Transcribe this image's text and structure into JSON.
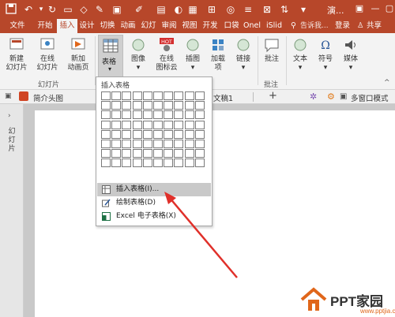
{
  "titlebar": {
    "title": "演..."
  },
  "tabs": {
    "file": "文件",
    "home": "开始",
    "insert": "插入",
    "design": "设计",
    "transitions": "切换",
    "animations": "动画",
    "slideshow": "幻灯",
    "review": "审阅",
    "view": "视图",
    "developer": "开发",
    "pocket": "口袋",
    "onekey": "Onel",
    "islide": "iSlid",
    "tell_me": "告诉我...",
    "login": "登录",
    "share": "共享"
  },
  "ribbon": {
    "new_slide": [
      "新建",
      "幻灯片"
    ],
    "online_slide": [
      "在线",
      "幻灯片"
    ],
    "add_anim_page": [
      "新加",
      "动画页"
    ],
    "table": "表格",
    "image": "图像",
    "online_icons": [
      "在线",
      "图标云"
    ],
    "illustrations": "插图",
    "addins": [
      "加载",
      "项"
    ],
    "links": "链接",
    "comment": "批注",
    "text": "文本",
    "symbols": "符号",
    "media": "媒体",
    "group_slides": "幻灯片",
    "group_comments": "批注",
    "hot_badge": "HOT"
  },
  "docbar": {
    "left_doc": "简介头图",
    "right_doc": "文稿1",
    "multi_window": "多窗口模式"
  },
  "leftpane": {
    "label": "幻灯片"
  },
  "dropdown": {
    "header": "插入表格",
    "insert_table": "插入表格(I)...",
    "draw_table": "绘制表格(D)",
    "excel_table": "Excel 电子表格(X)"
  },
  "watermark": {
    "brand": "PPT家园",
    "url": "www.pptjia.com"
  },
  "colors": {
    "accent": "#b7472a",
    "arrow": "#e0302a"
  }
}
